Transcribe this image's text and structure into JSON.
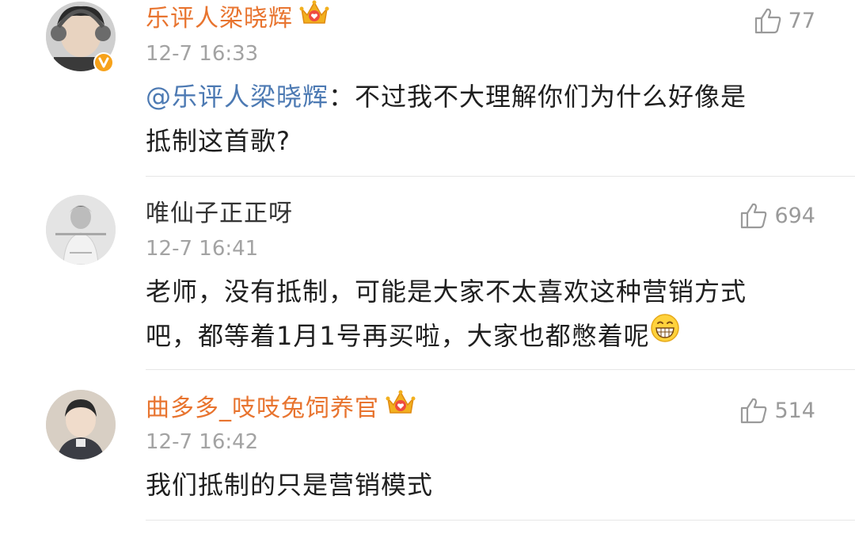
{
  "comments": [
    {
      "username": "乐评人梁晓辉",
      "timestamp": "12-7 16:33",
      "likes": "77",
      "mention": "@乐评人梁晓辉",
      "text": "：不过我不大理解你们为什么好像是抵制这首歌?",
      "text_line1": "：不过我不大理解你们为什么好像是",
      "text_line2": "抵制这首歌?",
      "vip": true,
      "verified": true
    },
    {
      "username": "唯仙子正正呀",
      "timestamp": "12-7 16:41",
      "likes": "694",
      "text_line1": "老师，没有抵制，可能是大家不太喜欢这种营销方式",
      "text_line2": "吧，都等着1月1号再买啦，大家也都憋着呢",
      "vip": false,
      "verified": false
    },
    {
      "username": "曲多多_吱吱兔饲养官",
      "timestamp": "12-7 16:42",
      "likes": "514",
      "text_line1": "我们抵制的只是营销模式",
      "vip": true,
      "verified": false
    }
  ],
  "icons": {
    "like": "thumbs-up-icon",
    "vip": "crown-icon",
    "verified": "verified-badge-icon",
    "emoji": "grin-emoji-icon"
  },
  "colors": {
    "vip_name": "#e8742f",
    "mention": "#4d7ab3",
    "timestamp": "#a3a3a3",
    "like": "#9a9a9a",
    "verified_badge": "#f7a21a"
  }
}
